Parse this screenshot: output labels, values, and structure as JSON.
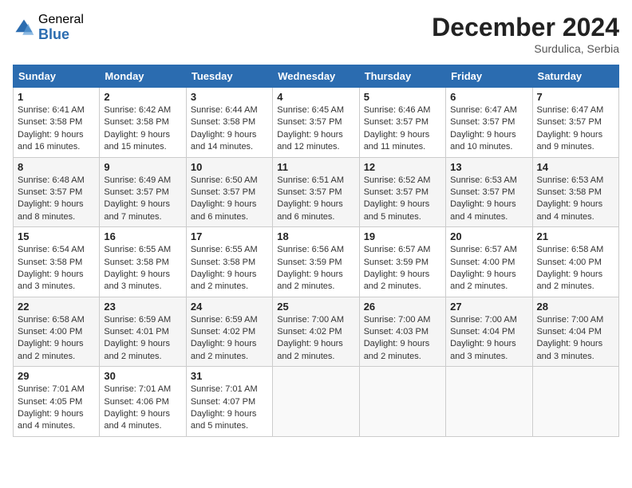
{
  "header": {
    "logo_general": "General",
    "logo_blue": "Blue",
    "month": "December 2024",
    "location": "Surdulica, Serbia"
  },
  "weekdays": [
    "Sunday",
    "Monday",
    "Tuesday",
    "Wednesday",
    "Thursday",
    "Friday",
    "Saturday"
  ],
  "weeks": [
    [
      {
        "day": 1,
        "lines": [
          "Sunrise: 6:41 AM",
          "Sunset: 3:58 PM",
          "Daylight: 9 hours",
          "and 16 minutes."
        ]
      },
      {
        "day": 2,
        "lines": [
          "Sunrise: 6:42 AM",
          "Sunset: 3:58 PM",
          "Daylight: 9 hours",
          "and 15 minutes."
        ]
      },
      {
        "day": 3,
        "lines": [
          "Sunrise: 6:44 AM",
          "Sunset: 3:58 PM",
          "Daylight: 9 hours",
          "and 14 minutes."
        ]
      },
      {
        "day": 4,
        "lines": [
          "Sunrise: 6:45 AM",
          "Sunset: 3:57 PM",
          "Daylight: 9 hours",
          "and 12 minutes."
        ]
      },
      {
        "day": 5,
        "lines": [
          "Sunrise: 6:46 AM",
          "Sunset: 3:57 PM",
          "Daylight: 9 hours",
          "and 11 minutes."
        ]
      },
      {
        "day": 6,
        "lines": [
          "Sunrise: 6:47 AM",
          "Sunset: 3:57 PM",
          "Daylight: 9 hours",
          "and 10 minutes."
        ]
      },
      {
        "day": 7,
        "lines": [
          "Sunrise: 6:47 AM",
          "Sunset: 3:57 PM",
          "Daylight: 9 hours",
          "and 9 minutes."
        ]
      }
    ],
    [
      {
        "day": 8,
        "lines": [
          "Sunrise: 6:48 AM",
          "Sunset: 3:57 PM",
          "Daylight: 9 hours",
          "and 8 minutes."
        ]
      },
      {
        "day": 9,
        "lines": [
          "Sunrise: 6:49 AM",
          "Sunset: 3:57 PM",
          "Daylight: 9 hours",
          "and 7 minutes."
        ]
      },
      {
        "day": 10,
        "lines": [
          "Sunrise: 6:50 AM",
          "Sunset: 3:57 PM",
          "Daylight: 9 hours",
          "and 6 minutes."
        ]
      },
      {
        "day": 11,
        "lines": [
          "Sunrise: 6:51 AM",
          "Sunset: 3:57 PM",
          "Daylight: 9 hours",
          "and 6 minutes."
        ]
      },
      {
        "day": 12,
        "lines": [
          "Sunrise: 6:52 AM",
          "Sunset: 3:57 PM",
          "Daylight: 9 hours",
          "and 5 minutes."
        ]
      },
      {
        "day": 13,
        "lines": [
          "Sunrise: 6:53 AM",
          "Sunset: 3:57 PM",
          "Daylight: 9 hours",
          "and 4 minutes."
        ]
      },
      {
        "day": 14,
        "lines": [
          "Sunrise: 6:53 AM",
          "Sunset: 3:58 PM",
          "Daylight: 9 hours",
          "and 4 minutes."
        ]
      }
    ],
    [
      {
        "day": 15,
        "lines": [
          "Sunrise: 6:54 AM",
          "Sunset: 3:58 PM",
          "Daylight: 9 hours",
          "and 3 minutes."
        ]
      },
      {
        "day": 16,
        "lines": [
          "Sunrise: 6:55 AM",
          "Sunset: 3:58 PM",
          "Daylight: 9 hours",
          "and 3 minutes."
        ]
      },
      {
        "day": 17,
        "lines": [
          "Sunrise: 6:55 AM",
          "Sunset: 3:58 PM",
          "Daylight: 9 hours",
          "and 2 minutes."
        ]
      },
      {
        "day": 18,
        "lines": [
          "Sunrise: 6:56 AM",
          "Sunset: 3:59 PM",
          "Daylight: 9 hours",
          "and 2 minutes."
        ]
      },
      {
        "day": 19,
        "lines": [
          "Sunrise: 6:57 AM",
          "Sunset: 3:59 PM",
          "Daylight: 9 hours",
          "and 2 minutes."
        ]
      },
      {
        "day": 20,
        "lines": [
          "Sunrise: 6:57 AM",
          "Sunset: 4:00 PM",
          "Daylight: 9 hours",
          "and 2 minutes."
        ]
      },
      {
        "day": 21,
        "lines": [
          "Sunrise: 6:58 AM",
          "Sunset: 4:00 PM",
          "Daylight: 9 hours",
          "and 2 minutes."
        ]
      }
    ],
    [
      {
        "day": 22,
        "lines": [
          "Sunrise: 6:58 AM",
          "Sunset: 4:00 PM",
          "Daylight: 9 hours",
          "and 2 minutes."
        ]
      },
      {
        "day": 23,
        "lines": [
          "Sunrise: 6:59 AM",
          "Sunset: 4:01 PM",
          "Daylight: 9 hours",
          "and 2 minutes."
        ]
      },
      {
        "day": 24,
        "lines": [
          "Sunrise: 6:59 AM",
          "Sunset: 4:02 PM",
          "Daylight: 9 hours",
          "and 2 minutes."
        ]
      },
      {
        "day": 25,
        "lines": [
          "Sunrise: 7:00 AM",
          "Sunset: 4:02 PM",
          "Daylight: 9 hours",
          "and 2 minutes."
        ]
      },
      {
        "day": 26,
        "lines": [
          "Sunrise: 7:00 AM",
          "Sunset: 4:03 PM",
          "Daylight: 9 hours",
          "and 2 minutes."
        ]
      },
      {
        "day": 27,
        "lines": [
          "Sunrise: 7:00 AM",
          "Sunset: 4:04 PM",
          "Daylight: 9 hours",
          "and 3 minutes."
        ]
      },
      {
        "day": 28,
        "lines": [
          "Sunrise: 7:00 AM",
          "Sunset: 4:04 PM",
          "Daylight: 9 hours",
          "and 3 minutes."
        ]
      }
    ],
    [
      {
        "day": 29,
        "lines": [
          "Sunrise: 7:01 AM",
          "Sunset: 4:05 PM",
          "Daylight: 9 hours",
          "and 4 minutes."
        ]
      },
      {
        "day": 30,
        "lines": [
          "Sunrise: 7:01 AM",
          "Sunset: 4:06 PM",
          "Daylight: 9 hours",
          "and 4 minutes."
        ]
      },
      {
        "day": 31,
        "lines": [
          "Sunrise: 7:01 AM",
          "Sunset: 4:07 PM",
          "Daylight: 9 hours",
          "and 5 minutes."
        ]
      },
      null,
      null,
      null,
      null
    ]
  ]
}
